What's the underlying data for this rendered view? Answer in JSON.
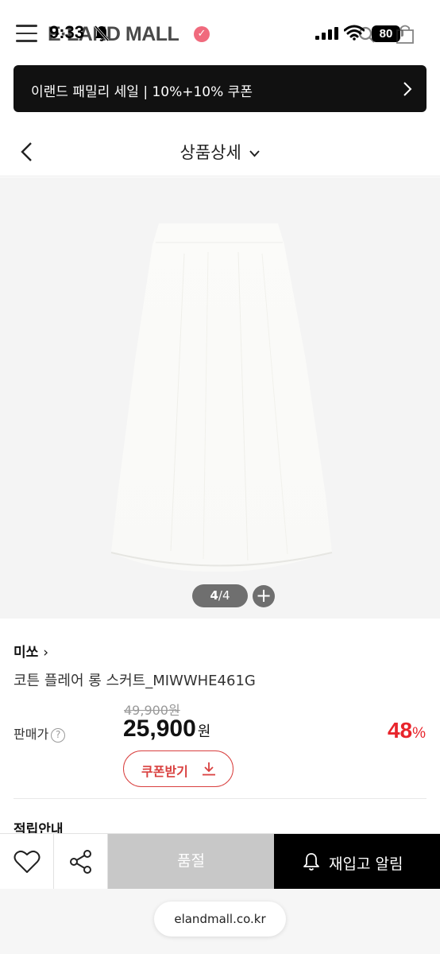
{
  "status_bar": {
    "time": "9:33",
    "battery": "80"
  },
  "app_header": {
    "logo": "E·LAND MALL"
  },
  "promo_banner": {
    "text": "이랜드 패밀리 세일 | 10%+10% 쿠폰"
  },
  "page_header": {
    "title": "상품상세"
  },
  "gallery": {
    "current": "4",
    "total": "/4",
    "plus": "+"
  },
  "product": {
    "brand": "미쏘",
    "name": "코튼 플레어 롱 스커트_MIWWHE461G",
    "original_price": "49,900원",
    "price_label": "판매가",
    "price": "25,900",
    "price_unit": "원",
    "discount": "48",
    "discount_unit": "%",
    "coupon_label": "쿠폰받기",
    "next_section": "적립안내"
  },
  "action_bar": {
    "soldout_label": "품절",
    "restock_label": "재입고 알림"
  },
  "browser": {
    "url": "elandmall.co.kr"
  },
  "icons": {
    "menu": "hamburger-icon",
    "search": "search-icon",
    "cart": "shopping-bag-icon",
    "back": "chevron-left-icon",
    "wish": "heart-icon",
    "share": "share-icon",
    "restock": "bell-icon",
    "download": "download-icon"
  },
  "colors": {
    "accent_red": "#e8242b",
    "coupon_red": "#d9403f",
    "soldout_gray": "#c8c8c8",
    "primary_black": "#000000"
  }
}
